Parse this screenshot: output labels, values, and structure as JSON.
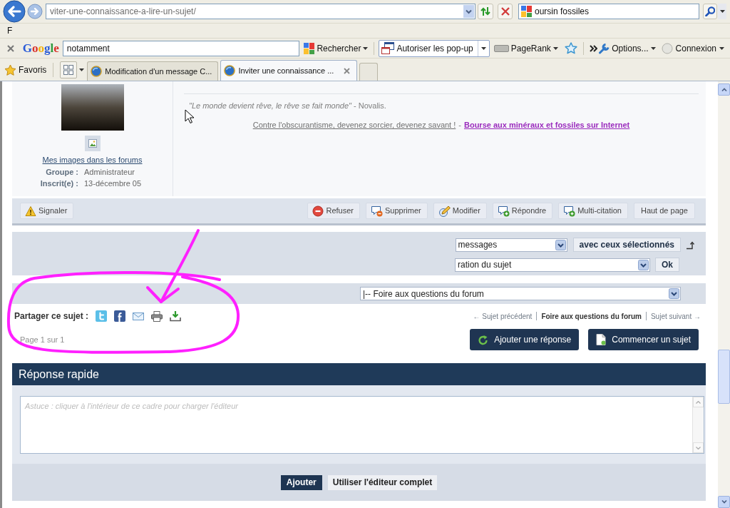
{
  "browser": {
    "address_bar": {
      "value": "viter-une-connaissance-a-lire-un-sujet/"
    },
    "search_box": {
      "value": "oursin fossiles"
    },
    "menu_bar": [
      {
        "label": "F"
      }
    ],
    "google_toolbar": {
      "logo": "Google",
      "query": "notamment",
      "search_button": "Rechercher",
      "popup_button": "Autoriser les pop-up",
      "pagerank_button": "PageRank",
      "options_menu": "Options...",
      "account_menu": "Connexion"
    },
    "favorites": "Favoris",
    "tabs": [
      {
        "title": "Modification d'un message C...",
        "selected": false
      },
      {
        "title": "Inviter une connaissance ...",
        "selected": true
      }
    ]
  },
  "post": {
    "profile_link": "Mes images dans les forums",
    "profile_fields": [
      {
        "label": "Groupe :",
        "value": "Administrateur"
      },
      {
        "label": "Inscrit(e) :",
        "value": "13-décembre 05"
      }
    ],
    "signature": {
      "quote": "*\"Le monde devient rêve, le rêve se fait monde\"* - Novalis.",
      "links": [
        {
          "text": "Contre l'obscurantisme, devenez sorcier, devenez savant !",
          "kind": "plain"
        },
        {
          "text": "Bourse aux minéraux et fossiles sur Internet",
          "kind": "featured"
        }
      ],
      "separator": "-"
    },
    "actions": [
      {
        "label": "Signaler",
        "kind": "report"
      },
      {
        "label": "Refuser",
        "kind": "refuse"
      },
      {
        "label": "Supprimer",
        "kind": "delete"
      },
      {
        "label": "Modifier",
        "kind": "edit"
      },
      {
        "label": "Répondre",
        "kind": "reply"
      },
      {
        "label": "Multi-citation",
        "kind": "quote"
      },
      {
        "label": "Haut de page",
        "kind": "top"
      }
    ]
  },
  "moderation": {
    "select_messages": "messages",
    "selection_button": "avec ceux sélectionnés",
    "select_action": "ration du sujet",
    "ok_button": "Ok"
  },
  "jump": {
    "forum_select": "|-- Foire aux questions du forum"
  },
  "share": {
    "label": "Partager ce sujet :"
  },
  "topic_nav": [
    {
      "label": "← Sujet précédent",
      "kind": "prev"
    },
    {
      "label": "Foire aux questions du forum",
      "kind": "forum"
    },
    {
      "label": "Sujet suivant →",
      "kind": "next"
    }
  ],
  "pagination": "Page 1 sur 1",
  "topic_buttons": [
    {
      "label": "Ajouter une réponse",
      "kind": "reply"
    },
    {
      "label": "Commencer un sujet",
      "kind": "new"
    }
  ],
  "quick_reply": {
    "title": "Réponse rapide",
    "placeholder": "Astuce : cliquer à l'intérieur de ce cadre pour charger l'éditeur",
    "buttons": [
      {
        "label": "Ajouter",
        "kind": "primary"
      },
      {
        "label": "Utiliser l'éditeur complet",
        "kind": "secondary"
      }
    ]
  }
}
